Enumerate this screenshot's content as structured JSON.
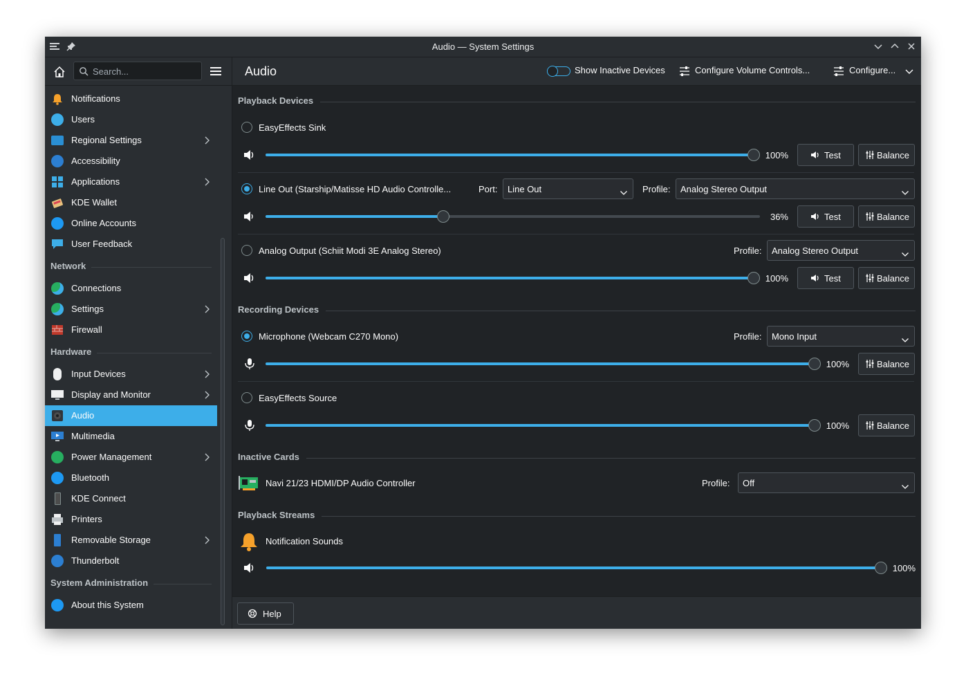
{
  "window": {
    "title": "Audio — System Settings"
  },
  "sidebar": {
    "search_placeholder": "Search...",
    "items_top": [
      {
        "label": "Notifications",
        "icon": "bell-icon"
      },
      {
        "label": "Users",
        "icon": "users-icon"
      },
      {
        "label": "Regional Settings",
        "icon": "regional-icon",
        "has_children": true
      },
      {
        "label": "Accessibility",
        "icon": "accessibility-icon"
      },
      {
        "label": "Applications",
        "icon": "applications-icon",
        "has_children": true
      },
      {
        "label": "KDE Wallet",
        "icon": "wallet-icon"
      },
      {
        "label": "Online Accounts",
        "icon": "online-accounts-icon"
      },
      {
        "label": "User Feedback",
        "icon": "feedback-icon"
      }
    ],
    "network": {
      "heading": "Network",
      "items": [
        {
          "label": "Connections",
          "icon": "globe-icon"
        },
        {
          "label": "Settings",
          "icon": "globe-icon",
          "has_children": true
        },
        {
          "label": "Firewall",
          "icon": "firewall-icon"
        }
      ]
    },
    "hardware": {
      "heading": "Hardware",
      "items": [
        {
          "label": "Input Devices",
          "icon": "mouse-icon",
          "has_children": true
        },
        {
          "label": "Display and Monitor",
          "icon": "monitor-icon",
          "has_children": true
        },
        {
          "label": "Audio",
          "icon": "speaker-icon",
          "selected": true
        },
        {
          "label": "Multimedia",
          "icon": "multimedia-icon"
        },
        {
          "label": "Power Management",
          "icon": "power-icon",
          "has_children": true
        },
        {
          "label": "Bluetooth",
          "icon": "bluetooth-icon"
        },
        {
          "label": "KDE Connect",
          "icon": "phone-icon"
        },
        {
          "label": "Printers",
          "icon": "printer-icon"
        },
        {
          "label": "Removable Storage",
          "icon": "usb-icon",
          "has_children": true
        },
        {
          "label": "Thunderbolt",
          "icon": "thunderbolt-icon"
        }
      ]
    },
    "sysadmin": {
      "heading": "System Administration",
      "items": [
        {
          "label": "About this System",
          "icon": "info-icon"
        }
      ]
    }
  },
  "header": {
    "page_title": "Audio",
    "show_inactive": "Show Inactive Devices",
    "configure_volume": "Configure Volume Controls...",
    "configure": "Configure..."
  },
  "playback": {
    "heading": "Playback Devices",
    "devices": [
      {
        "name": "EasyEffects Sink",
        "selected": false,
        "volume": 100,
        "volume_label": "100%"
      },
      {
        "name": "Line Out (Starship/Matisse HD Audio Controlle...",
        "selected": true,
        "port_label": "Port:",
        "port": "Line Out",
        "profile_label": "Profile:",
        "profile": "Analog Stereo Output",
        "volume": 36,
        "volume_label": "36%"
      },
      {
        "name": "Analog Output (Schiit Modi 3E Analog Stereo)",
        "selected": false,
        "profile_label": "Profile:",
        "profile": "Analog Stereo Output",
        "volume": 100,
        "volume_label": "100%"
      }
    ],
    "test_label": "Test",
    "balance_label": "Balance"
  },
  "recording": {
    "heading": "Recording Devices",
    "devices": [
      {
        "name": "Microphone (Webcam C270 Mono)",
        "selected": true,
        "profile_label": "Profile:",
        "profile": "Mono Input",
        "volume": 100,
        "volume_label": "100%"
      },
      {
        "name": "EasyEffects Source",
        "selected": false,
        "volume": 100,
        "volume_label": "100%"
      }
    ]
  },
  "inactive": {
    "heading": "Inactive Cards",
    "card": {
      "name": "Navi 21/23 HDMI/DP Audio Controller",
      "profile_label": "Profile:",
      "profile": "Off"
    }
  },
  "streams": {
    "heading": "Playback Streams",
    "stream": {
      "name": "Notification Sounds",
      "volume": 100,
      "volume_label": "100%"
    }
  },
  "footer": {
    "help_label": "Help"
  },
  "colors": {
    "accent": "#3daee9",
    "window_bg": "#202326",
    "panel_bg": "#2a2e32"
  }
}
